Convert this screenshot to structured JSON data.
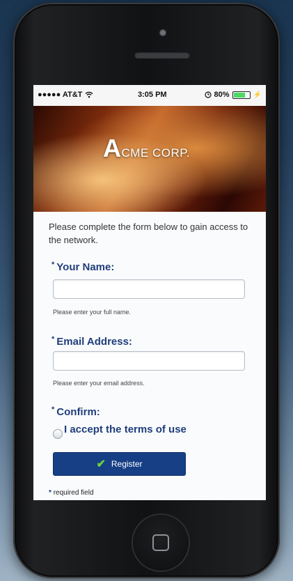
{
  "status_bar": {
    "carrier": "●●●●● AT&T",
    "time": "3:05 PM",
    "battery_percent": "80%",
    "battery_level": 0.8
  },
  "banner": {
    "brand_initial": "A",
    "brand_rest": "CME CORP."
  },
  "form": {
    "intro": "Please complete the form below to gain access to the network.",
    "required_marker": "*",
    "name_label": "Your Name:",
    "name_value": "",
    "name_hint": "Please enter your full name.",
    "email_label": "Email Address:",
    "email_value": "",
    "email_hint": "Please enter your email address.",
    "confirm_label": "Confirm:",
    "terms_label": "I accept the terms of use",
    "terms_checked": false,
    "register_label": "Register",
    "required_note": "required field"
  },
  "icons": {
    "wifi": "wifi-icon",
    "alarm": "alarm-icon",
    "battery": "battery-icon",
    "charging": "charging-icon",
    "check": "checkmark-icon",
    "home": "home-button-icon"
  },
  "colors": {
    "label_blue": "#1f3e7a",
    "button_blue": "#163f86",
    "check_green": "#6fd23c",
    "battery_green": "#4cd964"
  }
}
